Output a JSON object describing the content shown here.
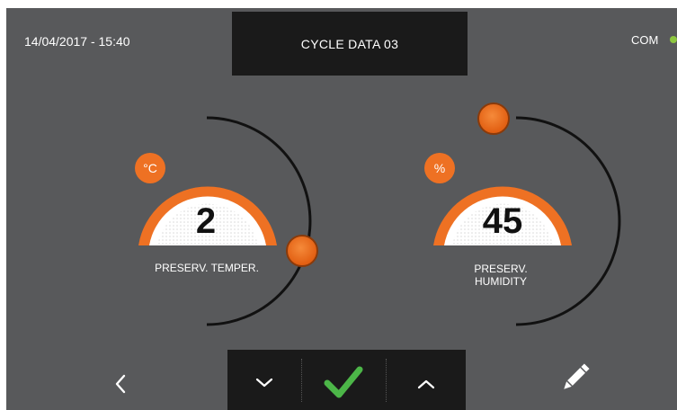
{
  "header": {
    "datetime": "14/04/2017 - 15:40",
    "title": "CYCLE DATA 03",
    "com_label": "COM"
  },
  "gauges": [
    {
      "unit": "°C",
      "value": "2",
      "label_line1": "PRESERV. TEMPER.",
      "label_line2": ""
    },
    {
      "unit": "%",
      "value": "45",
      "label_line1": "PRESERV.",
      "label_line2": "HUMIDITY"
    }
  ],
  "icons": {
    "back": "chevron-left-icon",
    "decrease": "chevron-down-icon",
    "confirm": "checkmark-icon",
    "increase": "chevron-up-icon",
    "edit": "pencil-icon"
  },
  "colors": {
    "background": "#58595b",
    "panel": "#1a1a1a",
    "accent": "#ee7123",
    "confirm": "#4cb648",
    "com_status": "#8dc63f"
  }
}
